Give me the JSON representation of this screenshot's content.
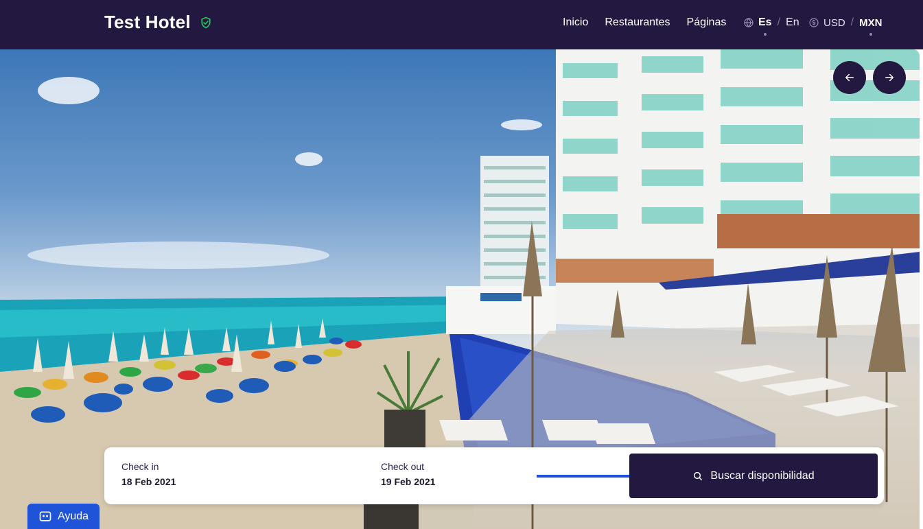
{
  "header": {
    "title": "Test Hotel",
    "nav": [
      "Inicio",
      "Restaurantes",
      "Páginas"
    ],
    "languages": [
      {
        "label": "Es",
        "active": true
      },
      {
        "label": "En",
        "active": false
      }
    ],
    "currencies": [
      {
        "label": "USD",
        "active": false
      },
      {
        "label": "MXN",
        "active": true
      }
    ],
    "separator": "/"
  },
  "booking": {
    "checkin_label": "Check in",
    "checkin_value": "18 Feb 2021",
    "checkout_label": "Check out",
    "checkout_value": "19 Feb 2021",
    "search_label": "Buscar disponibilidad"
  },
  "help": {
    "label": "Ayuda"
  },
  "colors": {
    "header_bg": "#221840",
    "primary": "#221840",
    "help_bg": "#1f54d8",
    "badge": "#22c55e",
    "pointer_arrow": "#1f4fe0"
  },
  "icons": [
    "verified-shield-icon",
    "globe-icon",
    "coin-icon",
    "arrow-left-icon",
    "arrow-right-icon",
    "search-icon",
    "chat-icon"
  ]
}
